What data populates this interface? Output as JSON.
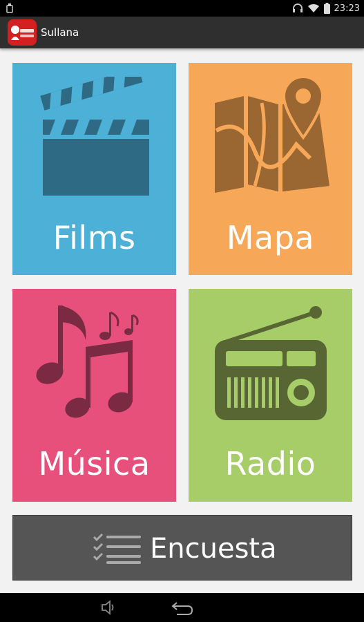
{
  "status_bar": {
    "time": "23:23",
    "icons": [
      "usb-icon",
      "headset-icon",
      "wifi-icon",
      "battery-icon"
    ]
  },
  "app_bar": {
    "title": "Sullana",
    "logo_icon": "app-logo-icon"
  },
  "tiles": [
    {
      "label": "Films",
      "icon": "clapperboard-icon",
      "color": "#4db0d6"
    },
    {
      "label": "Mapa",
      "icon": "map-pin-icon",
      "color": "#f6a858"
    },
    {
      "label": "Música",
      "icon": "music-notes-icon",
      "color": "#e6507a"
    },
    {
      "label": "Radio",
      "icon": "radio-icon",
      "color": "#a6cd68"
    }
  ],
  "encuesta": {
    "label": "Encuesta",
    "icon": "checklist-icon",
    "color": "#555555"
  },
  "nav_bar": {
    "icons": [
      "volume-icon",
      "back-icon"
    ]
  }
}
